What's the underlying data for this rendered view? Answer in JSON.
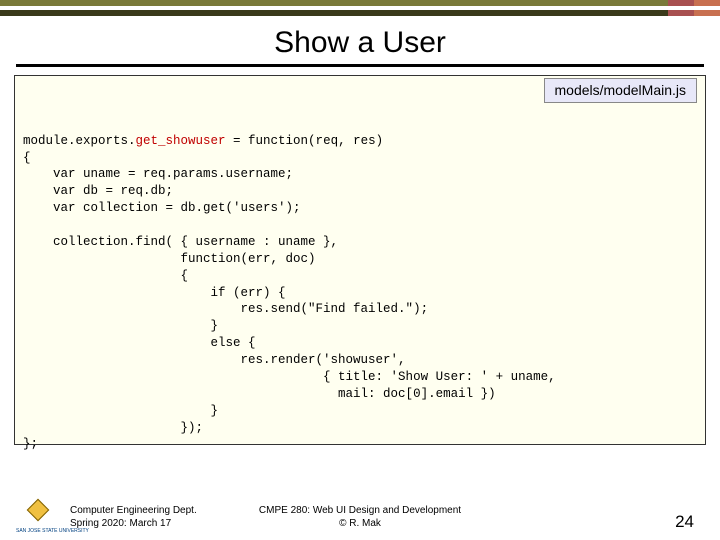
{
  "title": "Show a User",
  "filename": "models/modelMain.js",
  "code_lines": [
    {
      "pre": "module.exports.",
      "fn": "get_showuser",
      "post": " = function(req, res)"
    },
    {
      "pre": "{"
    },
    {
      "pre": "    var uname = req.params.username;"
    },
    {
      "pre": "    var db = req.db;"
    },
    {
      "pre": "    var collection = db.get('users');"
    },
    {
      "pre": ""
    },
    {
      "pre": "    collection.find( { username : uname },"
    },
    {
      "pre": "                     function(err, doc)"
    },
    {
      "pre": "                     {"
    },
    {
      "pre": "                         if (err) {"
    },
    {
      "pre": "                             res.send(\"Find failed.\");"
    },
    {
      "pre": "                         }"
    },
    {
      "pre": "                         else {"
    },
    {
      "pre": "                             res.render('showuser',"
    },
    {
      "pre": "                                        { title: 'Show User: ' + uname,"
    },
    {
      "pre": "                                          mail: doc[0].email })"
    },
    {
      "pre": "                         }"
    },
    {
      "pre": "                     });"
    },
    {
      "pre": "};"
    }
  ],
  "footer": {
    "dept_line1": "Computer Engineering Dept.",
    "dept_line2": "Spring 2020: March 17",
    "course_line1": "CMPE 280: Web UI Design and Development",
    "course_line2": "© R. Mak",
    "logo_text": "SAN JOSE STATE UNIVERSITY"
  },
  "page_number": "24"
}
